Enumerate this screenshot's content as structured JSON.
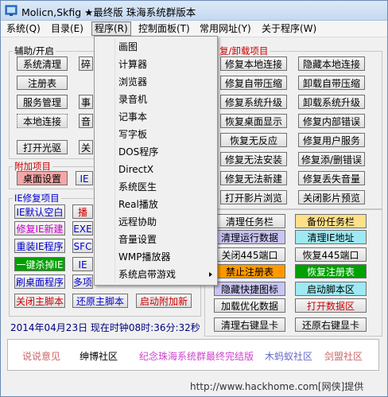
{
  "window": {
    "title": "Molicn,Skfig ★最终版 珠海系统群版本"
  },
  "menubar": [
    "系统(Q)",
    "目录(E)",
    "程序(R)",
    "控制面板(T)",
    "常用网址(Y)",
    "关于程序(W)"
  ],
  "left_group": {
    "legend": "辅助/开启",
    "buttons": [
      "系统清理",
      "注册表",
      "服务管理",
      "本地连接",
      "打开光驱",
      "碎",
      "事",
      "音",
      "关"
    ]
  },
  "attach_group": {
    "legend": "附加项目",
    "buttons": [
      "桌面设置",
      "IE"
    ]
  },
  "ie_group": {
    "legend": "IE修复项目",
    "buttons": [
      "IE默认空白",
      "播",
      "修复IE新建",
      "EXE",
      "重装IE程序",
      "SFC",
      "一键杀掉IE",
      "IE",
      "刷桌面程序",
      "多项",
      "关闭主脚本",
      "还原主脚本",
      "启动附加新"
    ]
  },
  "right_group": {
    "legend": "复/卸载项目",
    "buttons": [
      "修复本地连接",
      "隐藏本地连接",
      "修复自带压缩",
      "卸载自带压缩",
      "修复系统升级",
      "卸载系统升级",
      "恢复桌面显示",
      "修复内部错误",
      "恢复无反应",
      "修复用户服务",
      "修复无法安装",
      "修复添/删错误",
      "修复无法新建",
      "修复丢失音量",
      "打开影片浏览",
      "关闭影片预览"
    ]
  },
  "bottom_right": {
    "buttons": [
      "清理任务栏",
      "备份任务栏",
      "清理运行数据",
      "清理IE地址",
      "关闭445端口",
      "恢复445端口",
      "禁止注册表",
      "恢复注册表",
      "隐藏快捷图标",
      "启动脚本区",
      "加载优化数据",
      "打开数据区",
      "清理右键显卡",
      "还原右键显卡"
    ]
  },
  "program_menu": {
    "items": [
      "画图",
      "计算器",
      "浏览器",
      "录音机",
      "记事本",
      "写字板",
      "DOS程序",
      "DirectX",
      "系统医生",
      "Real播放",
      "远程协助",
      "音量设置",
      "WMP播放器",
      "系统启带游戏"
    ]
  },
  "clock": "2014年04月23日 现在时钟08时:36分:32秒",
  "links": [
    "说说意见",
    "绅博社区",
    "纪念珠海系统群最终完结版",
    "木蚂蚁社区",
    "剑盟社区"
  ],
  "footer": "http://www.hackhome.com[网侠]提供",
  "colors": {
    "red": "#cc0000",
    "blue": "#0000cc",
    "green_btn": "#00a000",
    "orange": "#ff9900",
    "pink": "#f4a7a7",
    "yellow_btn": "#ffe08a",
    "cyan_btn": "#9ee9f2",
    "purple_link": "#cc44cc"
  }
}
